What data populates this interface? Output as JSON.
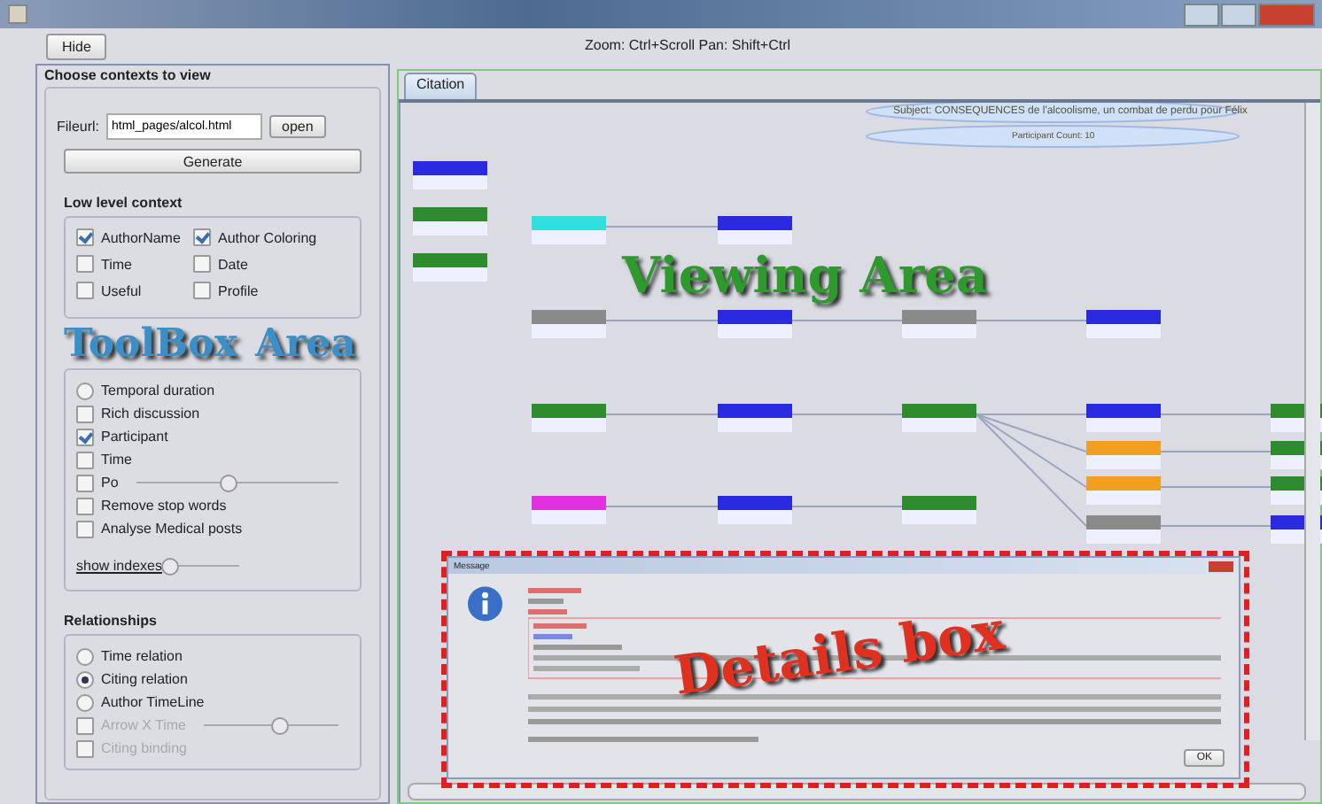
{
  "toolbar": {
    "hide_button": "Hide",
    "hint": "Zoom: Ctrl+Scroll   Pan: Shift+Ctrl"
  },
  "toolbox": {
    "title": "Choose contexts to view",
    "fileurl_label": "Fileurl:",
    "fileurl_value": "html_pages/alcol.html",
    "open_button": "open",
    "generate_button": "Generate",
    "low_level": {
      "title": "Low level context",
      "options": [
        {
          "label": "AuthorName",
          "checked": true
        },
        {
          "label": "Author Coloring",
          "checked": true
        },
        {
          "label": "Time",
          "checked": false
        },
        {
          "label": "Date",
          "checked": false
        },
        {
          "label": "Useful",
          "checked": false
        },
        {
          "label": "Profile",
          "checked": false
        }
      ]
    },
    "options": [
      {
        "kind": "radio",
        "label": "Temporal duration",
        "selected": false
      },
      {
        "kind": "checkbox",
        "label": "Rich discussion",
        "checked": false
      },
      {
        "kind": "checkbox",
        "label": "Participant",
        "checked": true
      },
      {
        "kind": "checkbox",
        "label": "Time",
        "checked": false
      },
      {
        "kind": "slider",
        "label": "Po",
        "checked": false,
        "level": 0.45
      },
      {
        "kind": "checkbox",
        "label": "Remove stop words",
        "checked": false
      },
      {
        "kind": "checkbox",
        "label": "Analyse Medical posts",
        "checked": false
      }
    ],
    "show_indexes": {
      "label": "show indexes",
      "level": 0
    },
    "relationships": {
      "title": "Relationships",
      "options": [
        {
          "kind": "radio",
          "label": "Time relation",
          "selected": false,
          "disabled": false
        },
        {
          "kind": "radio",
          "label": "Citing relation",
          "selected": true,
          "disabled": false
        },
        {
          "kind": "radio",
          "label": "Author TimeLine",
          "selected": false,
          "disabled": false
        },
        {
          "kind": "slider",
          "label": "Arrow X Time",
          "checked": false,
          "disabled": true,
          "level": 0.55
        },
        {
          "kind": "checkbox",
          "label": "Citing binding",
          "checked": false,
          "disabled": true
        }
      ]
    }
  },
  "viewer": {
    "tabs": [
      {
        "label": "Citation",
        "selected": true
      }
    ],
    "subject": "Subject: CONSEQUENCES de l'alcoolisme, un combat de perdu pour Félix",
    "participants": "Participant Count: 10",
    "nodes": [
      {
        "color": "#2a2ae0"
      },
      {
        "color": "#2e8b2e"
      },
      {
        "color": "#2e8b2e"
      },
      {
        "color": "#30e0e0"
      },
      {
        "color": "#8a8a8a"
      },
      {
        "color": "#2e8b2e"
      },
      {
        "color": "#e030e0"
      },
      {
        "color": "#2a2ae0"
      },
      {
        "color": "#2a2ae0"
      },
      {
        "color": "#2a2ae0"
      },
      {
        "color": "#2a2ae0"
      },
      {
        "color": "#8a8a8a"
      },
      {
        "color": "#2e8b2e"
      },
      {
        "color": "#2e8b2e"
      },
      {
        "color": "#2a2ae0"
      },
      {
        "color": "#2a2ae0"
      },
      {
        "color": "#f0a020"
      },
      {
        "color": "#f0a020"
      },
      {
        "color": "#8a8a8a"
      },
      {
        "color": "#2e8b2e"
      },
      {
        "color": "#2e8b2e"
      },
      {
        "color": "#2e8b2e"
      },
      {
        "color": "#2a2ae0"
      }
    ]
  },
  "dialog": {
    "title": "Message",
    "ok_button": "OK"
  },
  "annotations": [
    {
      "text": "ToolBox",
      "color": "#3a8fc8"
    },
    {
      "text": "Area",
      "color": "#3a8fc8"
    },
    {
      "text": "Viewing Area",
      "color": "#2e9a2e"
    },
    {
      "text": "Details box",
      "color": "#e03020"
    }
  ]
}
